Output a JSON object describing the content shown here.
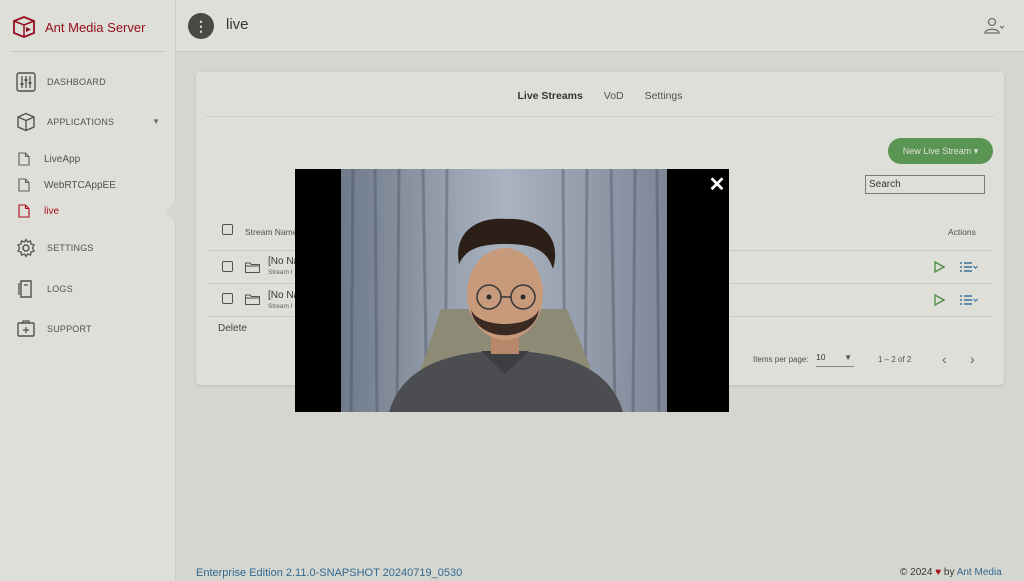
{
  "brand": {
    "name": "Ant Media Server",
    "color": "#a6001f"
  },
  "sidebar": {
    "items": [
      {
        "label": "DASHBOARD",
        "icon": "dashboard-sliders-icon"
      },
      {
        "label": "APPLICATIONS",
        "icon": "cube-icon"
      },
      {
        "label": "SETTINGS",
        "icon": "gear-icon"
      },
      {
        "label": "LOGS",
        "icon": "logs-icon"
      },
      {
        "label": "SUPPORT",
        "icon": "support-icon"
      }
    ],
    "applications": [
      {
        "label": "LiveApp",
        "icon": "file-icon"
      },
      {
        "label": "WebRTCAppEE",
        "icon": "file-icon"
      },
      {
        "label": "live",
        "icon": "file-icon",
        "active": true
      }
    ]
  },
  "header": {
    "menu_glyph": "⋮",
    "title": "live"
  },
  "tabs": [
    {
      "label": "Live Streams",
      "active": true
    },
    {
      "label": "VoD"
    },
    {
      "label": "Settings"
    }
  ],
  "toolbar": {
    "new_stream_label": "New Live Stream ▾",
    "search_placeholder": "Search"
  },
  "table": {
    "columns": {
      "name": "Stream Name",
      "actions": "Actions"
    },
    "rows": [
      {
        "name": "[No Na",
        "sub": "Stream I"
      },
      {
        "name": "[No Na",
        "sub": "Stream I"
      }
    ],
    "delete_label": "Delete"
  },
  "pagination": {
    "items_per_page_label": "Items per page:",
    "items_per_page": "10",
    "range": "1 – 2 of 2",
    "prev": "‹",
    "next": "›"
  },
  "footer": {
    "edition": "Enterprise Edition 2.11.0-SNAPSHOT 20240719_0530",
    "copyright": "© 2024",
    "by": "by",
    "company": "Ant Media"
  },
  "modal": {
    "close_glyph": "✕"
  },
  "colors": {
    "accent_green": "#5fa55f",
    "active_red": "#c2001c",
    "link_blue": "#2f6fa8"
  }
}
